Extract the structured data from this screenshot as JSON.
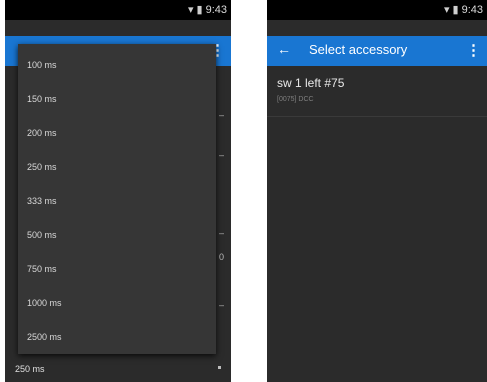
{
  "status_bar": {
    "time": "9:43",
    "wifi_icon": "wifi-icon",
    "battery_icon": "battery-icon"
  },
  "left_screen": {
    "overflow_icon": "more-vert-icon",
    "dropdown_options": [
      "100 ms",
      "150 ms",
      "200 ms",
      "250 ms",
      "333 ms",
      "500 ms",
      "750 ms",
      "1000 ms",
      "2500 ms"
    ],
    "selected_value": "250 ms",
    "side_peek_value": "0"
  },
  "right_screen": {
    "title": "Select accessory",
    "back_icon": "arrow-back-icon",
    "overflow_icon": "more-vert-icon",
    "items": [
      {
        "title": "sw 1 left #75",
        "subtitle": "[0075] DCC"
      }
    ]
  }
}
